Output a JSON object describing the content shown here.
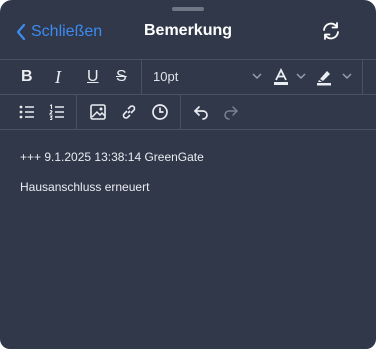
{
  "header": {
    "close_label": "Schließen",
    "title": "Bemerkung",
    "icons": {
      "back": "chevron-left-icon",
      "sync": "refresh-icon"
    }
  },
  "toolbar": {
    "bold": "B",
    "italic": "I",
    "underline": "U",
    "strikethrough": "S",
    "font_size": "10pt",
    "icons": [
      "text-color-icon",
      "highlight-icon",
      "bullet-list-icon",
      "numbered-list-icon",
      "image-icon",
      "link-icon",
      "clock-icon",
      "undo-icon",
      "redo-icon"
    ]
  },
  "content": {
    "lines": [
      "+++ 9.1.2025 13:38:14 GreenGate",
      "Hausanschluss erneuert"
    ]
  },
  "colors": {
    "background": "#313849",
    "accent": "#3d8bf0",
    "text": "#e9ecf1",
    "divider": "#4a5163"
  }
}
